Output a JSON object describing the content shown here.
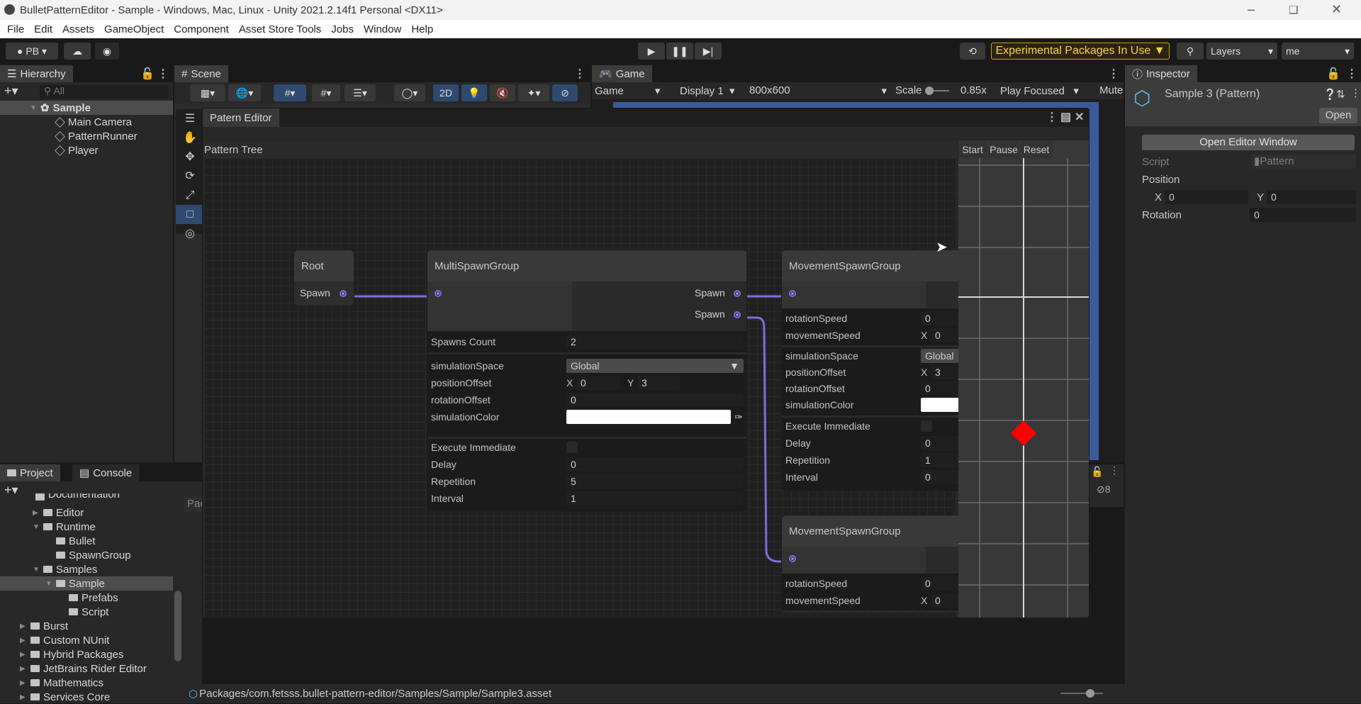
{
  "window": {
    "title": "BulletPatternEditor - Sample - Windows, Mac, Linux - Unity 2021.2.14f1 Personal <DX11>"
  },
  "menu": [
    "File",
    "Edit",
    "Assets",
    "GameObject",
    "Component",
    "Asset Store Tools",
    "Jobs",
    "Window",
    "Help"
  ],
  "toolbar": {
    "account": "PB",
    "experimental": "Experimental Packages In Use",
    "layers": "Layers",
    "layout": "me"
  },
  "hierarchy": {
    "tab": "Hierarchy",
    "search_placeholder": "All",
    "scene": "Sample",
    "items": [
      "Main Camera",
      "PatternRunner",
      "Player"
    ]
  },
  "scene": {
    "tab": "Scene",
    "mode_2d": "2D"
  },
  "game": {
    "tab": "Game",
    "view": "Game",
    "display": "Display 1",
    "resolution": "800x600",
    "scale_label": "Scale",
    "scale_value": "0.85x",
    "play_mode": "Play Focused",
    "mute": "Mute"
  },
  "inspector": {
    "tab": "Inspector",
    "asset_name": "Sample 3 (Pattern)",
    "open_button": "Open",
    "open_editor_button": "Open Editor Window",
    "script_label": "Script",
    "script_value": "Pattern",
    "position_label": "Position",
    "x_label": "X",
    "x_value": "0",
    "y_label": "Y",
    "y_value": "0",
    "rotation_label": "Rotation",
    "rotation_value": "0"
  },
  "project": {
    "tab": "Project",
    "console_tab": "Console",
    "partial_top": "Documentation",
    "breadcrumb_partial": "Pac",
    "items": [
      {
        "label": "Editor",
        "depth": 2,
        "expanded": false,
        "arrow": true
      },
      {
        "label": "Runtime",
        "depth": 2,
        "expanded": true,
        "arrow": true
      },
      {
        "label": "Bullet",
        "depth": 3,
        "arrow": false
      },
      {
        "label": "SpawnGroup",
        "depth": 3,
        "arrow": false
      },
      {
        "label": "Samples",
        "depth": 2,
        "expanded": true,
        "arrow": true
      },
      {
        "label": "Sample",
        "depth": 3,
        "expanded": true,
        "arrow": true,
        "selected": true
      },
      {
        "label": "Prefabs",
        "depth": 4,
        "arrow": false
      },
      {
        "label": "Script",
        "depth": 4,
        "arrow": false
      },
      {
        "label": "Burst",
        "depth": 1,
        "arrow": true
      },
      {
        "label": "Custom NUnit",
        "depth": 1,
        "arrow": true
      },
      {
        "label": "Hybrid Packages",
        "depth": 1,
        "arrow": true
      },
      {
        "label": "JetBrains Rider Editor",
        "depth": 1,
        "arrow": true
      },
      {
        "label": "Mathematics",
        "depth": 1,
        "arrow": true
      },
      {
        "label": "Services Core",
        "depth": 1,
        "arrow": true
      }
    ],
    "status_path": "Packages/com.fetsss.bullet-pattern-editor/Samples/Sample/Sample3.asset",
    "hidden_count": "8"
  },
  "pattern_editor": {
    "tab": "Patern Editor",
    "tree_label": "Pattern Tree",
    "preview_buttons": [
      "Start",
      "Pause",
      "Reset"
    ],
    "root": {
      "title": "Root",
      "port": "Spawn"
    },
    "multi": {
      "title": "MultiSpawnGroup",
      "ports": [
        "Spawn",
        "Spawn"
      ],
      "spawns_count_label": "Spawns Count",
      "spawns_count": "2",
      "simulationSpace_label": "simulationSpace",
      "simulationSpace": "Global",
      "positionOffset_label": "positionOffset",
      "pos_x_label": "X",
      "pos_x": "0",
      "pos_y_label": "Y",
      "pos_y": "3",
      "rotationOffset_label": "rotationOffset",
      "rotationOffset": "0",
      "simulationColor_label": "simulationColor",
      "simulationColor": "#ffffff",
      "executeImmediate_label": "Execute Immediate",
      "executeImmediate": false,
      "delay_label": "Delay",
      "delay": "0",
      "repetition_label": "Repetition",
      "repetition": "5",
      "interval_label": "Interval",
      "interval": "1"
    },
    "movement1": {
      "title": "MovementSpawnGroup",
      "rotationSpeed_label": "rotationSpeed",
      "rotationSpeed": "0",
      "movementSpeed_label": "movementSpeed",
      "mv_x_label": "X",
      "mv_x": "0",
      "simulationSpace_label": "simulationSpace",
      "simulationSpace": "Global",
      "positionOffset_label": "positionOffset",
      "pos_x_label": "X",
      "pos_x": "3",
      "rotationOffset_label": "rotationOffset",
      "rotationOffset": "0",
      "simulationColor_label": "simulationColor",
      "simulationColor": "#ffffff",
      "executeImmediate_label": "Execute Immediate",
      "executeImmediate": false,
      "delay_label": "Delay",
      "delay": "0",
      "repetition_label": "Repetition",
      "repetition": "1",
      "interval_label": "Interval",
      "interval": "0"
    },
    "movement2": {
      "title": "MovementSpawnGroup",
      "rotationSpeed_label": "rotationSpeed",
      "rotationSpeed": "0",
      "movementSpeed_label": "movementSpeed",
      "mv_x_label": "X",
      "mv_x": "0"
    },
    "colors": {
      "edge": "#7b6fd8",
      "bullet": "#ff0000",
      "accent_blue": "#3a5a9a",
      "warning": "#f0c000"
    }
  }
}
